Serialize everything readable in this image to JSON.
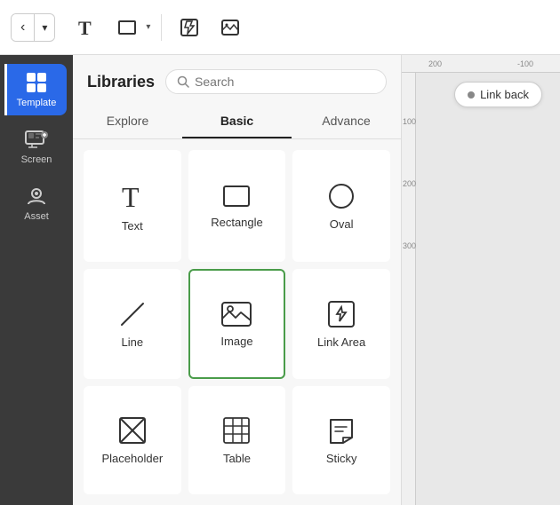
{
  "toolbar": {
    "back_label": "‹",
    "dropdown_label": "▾",
    "text_icon": "T",
    "rect_icon": "rect",
    "flash_icon": "flash",
    "image_icon": "img"
  },
  "sidebar": {
    "items": [
      {
        "id": "template",
        "label": "Template",
        "active": true
      },
      {
        "id": "screen",
        "label": "Screen",
        "active": false
      },
      {
        "id": "asset",
        "label": "Asset",
        "active": false
      }
    ]
  },
  "libraries": {
    "title": "Libraries",
    "search_placeholder": "Search",
    "tabs": [
      {
        "id": "explore",
        "label": "Explore",
        "active": false
      },
      {
        "id": "basic",
        "label": "Basic",
        "active": true
      },
      {
        "id": "advance",
        "label": "Advance",
        "active": false
      }
    ],
    "grid_items": [
      {
        "id": "text",
        "label": "Text",
        "icon": "text"
      },
      {
        "id": "rectangle",
        "label": "Rectangle",
        "icon": "rectangle"
      },
      {
        "id": "oval",
        "label": "Oval",
        "icon": "oval"
      },
      {
        "id": "line",
        "label": "Line",
        "icon": "line"
      },
      {
        "id": "image",
        "label": "Image",
        "icon": "image",
        "selected": true
      },
      {
        "id": "link-area",
        "label": "Link Area",
        "icon": "link-area"
      },
      {
        "id": "placeholder",
        "label": "Placeholder",
        "icon": "placeholder"
      },
      {
        "id": "table",
        "label": "Table",
        "icon": "table"
      },
      {
        "id": "sticky",
        "label": "Sticky",
        "icon": "sticky"
      }
    ]
  },
  "canvas": {
    "ruler_marks_top": [
      "200",
      "-100"
    ],
    "ruler_marks_left": [
      "100",
      "200",
      "300"
    ],
    "link_back_label": "Link back"
  }
}
